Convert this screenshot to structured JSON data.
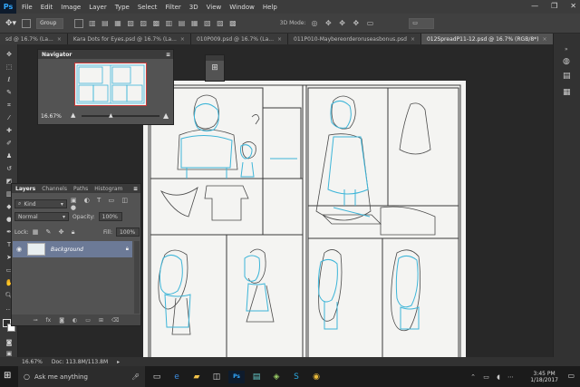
{
  "app": {
    "logo": "Ps"
  },
  "menu": [
    "File",
    "Edit",
    "Image",
    "Layer",
    "Type",
    "Select",
    "Filter",
    "3D",
    "View",
    "Window",
    "Help"
  ],
  "window_controls": [
    "—",
    "❐",
    "✕"
  ],
  "options": {
    "group_value": "Group",
    "mode3d_label": "3D Mode:"
  },
  "tabs": [
    {
      "label": "sd @ 16.7% (La...",
      "active": false
    },
    {
      "label": "Kara Dots for Eyes.psd @ 16.7% (La...",
      "active": false
    },
    {
      "label": "010P009.psd @ 16.7% (La...",
      "active": false
    },
    {
      "label": "011P010-Maybereorderoruseasbonus.psd",
      "active": false
    },
    {
      "label": "012SpreadP11-12.psd @ 16.7% (RGB/8*)",
      "active": true
    }
  ],
  "navigator": {
    "title": "Navigator",
    "zoom": "16.67%"
  },
  "layers": {
    "tabs": [
      "Layers",
      "Channels",
      "Paths",
      "Histogram"
    ],
    "kind_label": "Kind",
    "blend_mode": "Normal",
    "opacity_label": "Opacity:",
    "opacity_value": "100%",
    "lock_label": "Lock:",
    "fill_label": "Fill:",
    "fill_value": "100%",
    "layer_name": "Background",
    "footer_icons": [
      "link-icon",
      "fx-icon",
      "mask-icon",
      "adjustment-icon",
      "folder-icon",
      "new-layer-icon",
      "trash-icon"
    ]
  },
  "status": {
    "zoom": "16.67%",
    "doc": "Doc: 113.8M/113.8M"
  },
  "taskbar": {
    "search_placeholder": "Ask me anything",
    "time": "3:45 PM",
    "date": "1/18/2017"
  },
  "colors": {
    "accent": "#31a8ff",
    "sketch_blue": "#3db5d8",
    "layer_sel": "#6c7a97"
  }
}
